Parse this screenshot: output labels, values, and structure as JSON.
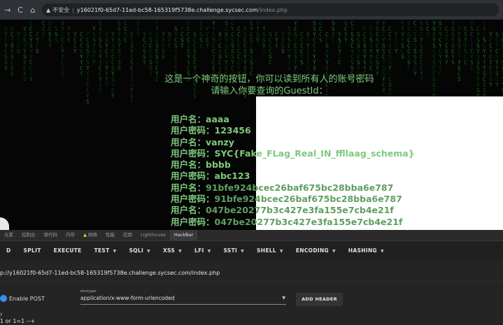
{
  "browser": {
    "nav_back": "→",
    "nav_reload": "C",
    "nav_home": "⌂",
    "security_icon": "warning-triangle-icon",
    "security_text": "不安全",
    "url_separator": "|",
    "url_host": "y16021f0-65d7-11ed-bc58-165319f5738e.challenge.sycsec.com",
    "url_path": "/index.php"
  },
  "page": {
    "intro_line1": "这是一个神奇的按钮，你可以读到所有人的账号密码",
    "intro_line2": "请输入你要查询的GuestId：",
    "guest_input_value": "",
    "results": [
      {
        "label": "用户名：",
        "value": "aaaa"
      },
      {
        "label": "用户密码：",
        "value": "123456"
      },
      {
        "label": "用户名：",
        "value": "vanzy"
      },
      {
        "label": "用户密码：",
        "value": "SYC{Fake_FLag_Real_IN_ffllaag_schema}"
      },
      {
        "label": "用户名：",
        "value": "bbbb"
      },
      {
        "label": "用户密码：",
        "value": "abc123"
      },
      {
        "label": "用户名：",
        "value": "91bfe924bcec26baf675bc28bba6e787"
      },
      {
        "label": "用户密码：",
        "value": "91bfe924bcec26baf675bc28bba6e787"
      },
      {
        "label": "用户名：",
        "value": "047be20277b3c427e3fa155e7cb4e21f"
      },
      {
        "label": "用户密码：",
        "value": "047be20277b3c427e3fa155e7cb4e21f"
      }
    ],
    "matrix_chars": "SYC",
    "matrix_color": "#1f8f1f"
  },
  "devtools": {
    "tabs": [
      {
        "label": "元素",
        "active": false,
        "warn": false
      },
      {
        "label": "控制台",
        "active": false,
        "warn": false
      },
      {
        "label": "源代码",
        "active": false,
        "warn": false
      },
      {
        "label": "内存",
        "active": false,
        "warn": false
      },
      {
        "label": "网络",
        "active": false,
        "warn": true
      },
      {
        "label": "性能",
        "active": false,
        "warn": false
      },
      {
        "label": "应用",
        "active": false,
        "warn": false
      },
      {
        "label": "Lighthouse",
        "active": false,
        "warn": false
      },
      {
        "label": "HackBar",
        "active": true,
        "warn": false
      }
    ],
    "hackbar": {
      "buttons": [
        {
          "label": "D",
          "dropdown": false
        },
        {
          "label": "SPLIT",
          "dropdown": false
        },
        {
          "label": "EXECUTE",
          "dropdown": false
        },
        {
          "label": "TEST",
          "dropdown": true
        },
        {
          "label": "SQLI",
          "dropdown": true
        },
        {
          "label": "XSS",
          "dropdown": true
        },
        {
          "label": "LFI",
          "dropdown": true
        },
        {
          "label": "SSTI",
          "dropdown": true
        },
        {
          "label": "SHELL",
          "dropdown": true
        },
        {
          "label": "ENCODING",
          "dropdown": true
        },
        {
          "label": "HASHING",
          "dropdown": true
        }
      ],
      "url_value": "p://y16021f0-65d7-11ed-bc58-165319f5738e.challenge.sycsec.com/index.php",
      "enable_post_label": "Enable POST",
      "enable_post_checked": true,
      "enctype_label": "enctype",
      "enctype_value": "application/x-www-form-urlencoded",
      "add_header_label": "ADD HEADER",
      "body_label": "y",
      "body_value": "1 or 1=1 --+"
    }
  },
  "colors": {
    "text_green": "#7ec97e",
    "accent_blue": "#3b8beb",
    "warning_yellow": "#f0c419"
  }
}
